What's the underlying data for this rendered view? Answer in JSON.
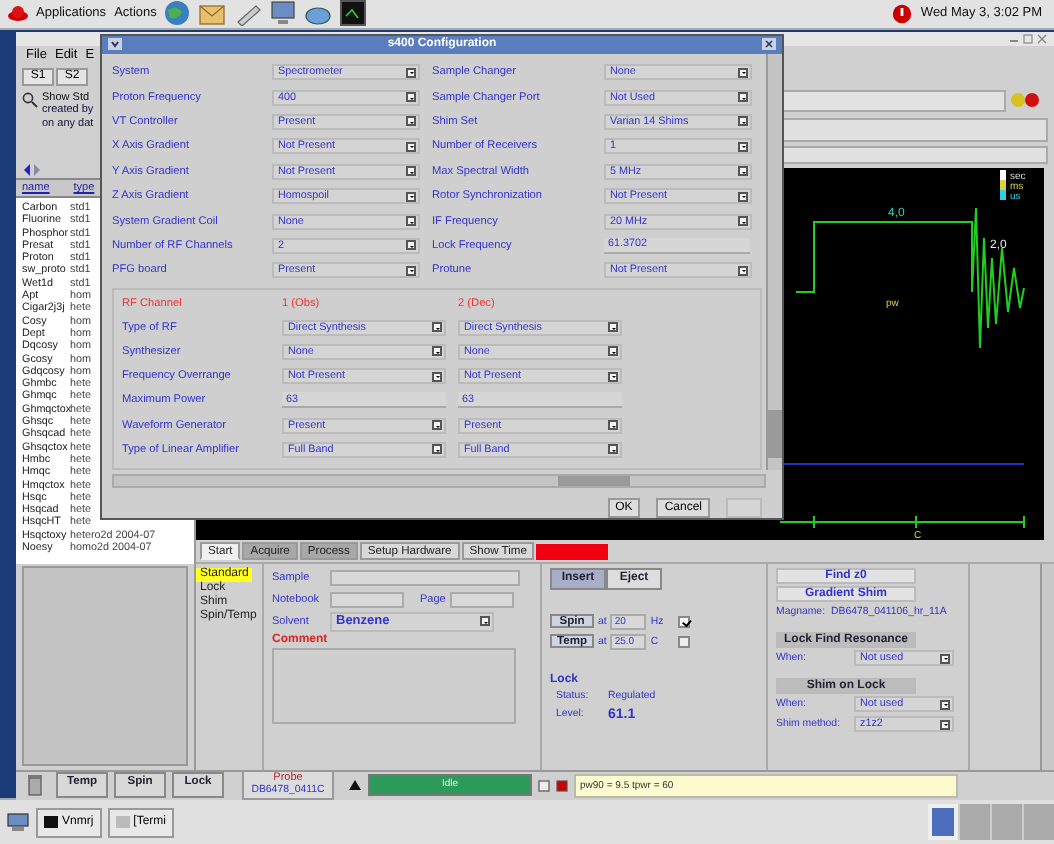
{
  "top_panel": {
    "menus": [
      "Applications",
      "Actions"
    ],
    "clock": "Wed May  3,  3:02 PM"
  },
  "main_window": {
    "menus": [
      "File",
      "Edit",
      "E"
    ],
    "toolbar": [
      "S1",
      "S2"
    ],
    "search": {
      "lines": [
        "Show Std",
        "created by",
        "on any dat"
      ]
    },
    "list": {
      "columns": [
        "name",
        "type"
      ],
      "rows": [
        {
          "name": "Carbon",
          "type": "std1"
        },
        {
          "name": "Fluorine",
          "type": "std1"
        },
        {
          "name": "Phosphor",
          "type": "std1"
        },
        {
          "name": "Presat",
          "type": "std1"
        },
        {
          "name": "Proton",
          "type": "std1"
        },
        {
          "name": "sw_proto",
          "type": "std1"
        },
        {
          "name": "Wet1d",
          "type": "std1"
        },
        {
          "name": "Apt",
          "type": "hom"
        },
        {
          "name": "Cigar2j3j",
          "type": "hete"
        },
        {
          "name": "Cosy",
          "type": "hom"
        },
        {
          "name": "Dept",
          "type": "hom"
        },
        {
          "name": "Dqcosy",
          "type": "hom"
        },
        {
          "name": "Gcosy",
          "type": "hom"
        },
        {
          "name": "Gdqcosy",
          "type": "hom"
        },
        {
          "name": "Ghmbc",
          "type": "hete"
        },
        {
          "name": "Ghmqc",
          "type": "hete"
        },
        {
          "name": "Ghmqctox",
          "type": "hete"
        },
        {
          "name": "Ghsqc",
          "type": "hete"
        },
        {
          "name": "Ghsqcad",
          "type": "hete"
        },
        {
          "name": "Ghsqctox",
          "type": "hete"
        },
        {
          "name": "Hmbc",
          "type": "hete"
        },
        {
          "name": "Hmqc",
          "type": "hete"
        },
        {
          "name": "Hmqctox",
          "type": "hete"
        },
        {
          "name": "Hsqc",
          "type": "hete"
        },
        {
          "name": "Hsqcad",
          "type": "hete"
        },
        {
          "name": "HsqcHT",
          "type": "hete"
        },
        {
          "name": "Hsqctoxy",
          "type": "hetero2d 2004-07"
        },
        {
          "name": "Noesy",
          "type": "homo2d 2004-07"
        }
      ]
    },
    "graph": {
      "legend": [
        "sec",
        "ms",
        "us"
      ],
      "pulse_label": "4,0",
      "fid_label": "2,0",
      "pw_label": "pw",
      "axis_label": "C"
    },
    "tabs": [
      {
        "label": "Start",
        "selected": true
      },
      {
        "label": "Acquire",
        "selected": false
      },
      {
        "label": "Process",
        "selected": false
      },
      {
        "label": "Setup Hardware",
        "selected": false
      },
      {
        "label": "Show Time",
        "selected": false
      }
    ],
    "nav": [
      {
        "label": "Standard",
        "selected": true
      },
      {
        "label": "Lock",
        "selected": false
      },
      {
        "label": "Shim",
        "selected": false
      },
      {
        "label": "Spin/Temp",
        "selected": false
      }
    ],
    "form": {
      "sample_label": "Sample",
      "notebook_label": "Notebook",
      "page_label": "Page",
      "solvent_label": "Solvent",
      "solvent": "Benzene",
      "comment_label": "Comment"
    },
    "sample_buttons": [
      "Insert",
      "Eject"
    ],
    "spin": {
      "button": "Spin",
      "at": "at",
      "value": "20",
      "unit": "Hz",
      "checked": true
    },
    "temp": {
      "button": "Temp",
      "at": "at",
      "value": "25.0",
      "unit": "C",
      "checked": false
    },
    "lock": {
      "title": "Lock",
      "status_label": "Status:",
      "status": "Regulated",
      "level_label": "Level:",
      "level_value": "61.1"
    },
    "shim": {
      "find_button": "Find z0",
      "gradient_button": "Gradient Shim",
      "magname_label": "Magname:",
      "magname": "DB6478_041106_hr_11A",
      "lfr_button": "Lock Find Resonance",
      "lfr_when_label": "When:",
      "lfr_when": "Not used",
      "sol_button": "Shim on Lock",
      "sol_when_label": "When:",
      "sol_when": "Not used",
      "method_label": "Shim method:",
      "method": "z1z2"
    },
    "status_bar": {
      "buttons": [
        "Temp",
        "Spin",
        "Lock"
      ],
      "probe_label": "Probe",
      "probe": "DB6478_0411C",
      "state": "Idle",
      "message": "pw90 = 9.5 tpwr = 60"
    }
  },
  "taskbar": [
    "Vnmrj",
    "[Termi"
  ],
  "dialog": {
    "title": "s400 Configuration",
    "left": [
      {
        "label": "System",
        "value": "Spectrometer",
        "kind": "select"
      },
      {
        "label": "Proton Frequency",
        "value": "400",
        "kind": "select"
      },
      {
        "label": "VT Controller",
        "value": "Present",
        "kind": "select"
      },
      {
        "label": "X Axis Gradient",
        "value": "Not Present",
        "kind": "select"
      },
      {
        "label": "Y Axis Gradient",
        "value": "Not Present",
        "kind": "select"
      },
      {
        "label": "Z Axis Gradient",
        "value": "Homospoil",
        "kind": "select"
      },
      {
        "label": "System Gradient Coil",
        "value": "None",
        "kind": "select"
      },
      {
        "label": "Number of RF Channels",
        "value": "2",
        "kind": "select"
      },
      {
        "label": "PFG board",
        "value": "Present",
        "kind": "select"
      }
    ],
    "right": [
      {
        "label": "Sample Changer",
        "value": "None",
        "kind": "select"
      },
      {
        "label": "Sample Changer Port",
        "value": "Not Used",
        "kind": "select"
      },
      {
        "label": "Shim Set",
        "value": "Varian 14 Shims",
        "kind": "select"
      },
      {
        "label": "Number of Receivers",
        "value": "1",
        "kind": "select"
      },
      {
        "label": "Max Spectral Width",
        "value": "5 MHz",
        "kind": "select"
      },
      {
        "label": "Rotor Synchronization",
        "value": "Not Present",
        "kind": "select"
      },
      {
        "label": "IF Frequency",
        "value": "20 MHz",
        "kind": "select"
      },
      {
        "label": "Lock Frequency",
        "value": "61.3702",
        "kind": "field"
      },
      {
        "label": "Protune",
        "value": "Not Present",
        "kind": "select"
      }
    ],
    "rf": {
      "header": "RF Channel",
      "channels": [
        "1 (Obs)",
        "2 (Dec)"
      ],
      "rows": [
        {
          "label": "Type of RF",
          "kind": "select",
          "values": [
            "Direct Synthesis",
            "Direct Synthesis"
          ]
        },
        {
          "label": "Synthesizer",
          "kind": "select",
          "values": [
            "None",
            "None"
          ]
        },
        {
          "label": "Frequency Overrange",
          "kind": "select",
          "values": [
            "Not Present",
            "Not Present"
          ]
        },
        {
          "label": "Maximum Power",
          "kind": "field",
          "values": [
            "63",
            "63"
          ]
        },
        {
          "label": "Waveform Generator",
          "kind": "select",
          "values": [
            "Present",
            "Present"
          ]
        },
        {
          "label": "Type of Linear Amplifier",
          "kind": "select",
          "values": [
            "Full Band",
            "Full Band"
          ]
        }
      ]
    },
    "buttons": [
      "OK",
      "Cancel"
    ]
  }
}
